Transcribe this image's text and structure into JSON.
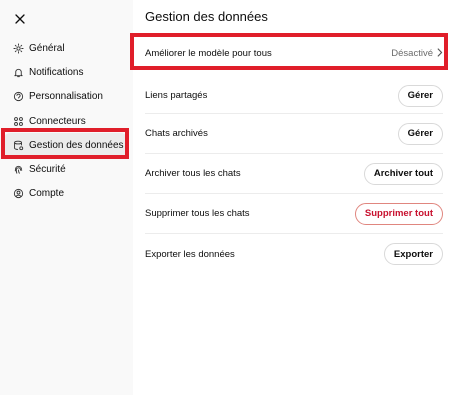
{
  "sidebar": {
    "close_icon": "close-icon",
    "items": [
      {
        "label": "Général",
        "icon": "gear-icon"
      },
      {
        "label": "Notifications",
        "icon": "bell-icon"
      },
      {
        "label": "Personnalisation",
        "icon": "personalization-icon"
      },
      {
        "label": "Connecteurs",
        "icon": "connectors-icon"
      },
      {
        "label": "Gestion des données",
        "icon": "database-icon",
        "active": true
      },
      {
        "label": "Sécurité",
        "icon": "fingerprint-icon"
      },
      {
        "label": "Compte",
        "icon": "account-icon"
      }
    ]
  },
  "main": {
    "title": "Gestion des données",
    "rows": [
      {
        "label": "Améliorer le modèle pour tous",
        "value": "Désactivé"
      },
      {
        "label": "Liens partagés",
        "button": "Gérer"
      },
      {
        "label": "Chats archivés",
        "button": "Gérer"
      },
      {
        "label": "Archiver tous les chats",
        "button": "Archiver tout"
      },
      {
        "label": "Supprimer tous les chats",
        "button": "Supprimer tout",
        "danger": true
      },
      {
        "label": "Exporter les données",
        "button": "Exporter"
      }
    ]
  },
  "colors": {
    "highlight": "#e01e2a",
    "danger": "#c8102e",
    "sidebar_bg": "#f9f9f9",
    "active_bg": "#ececec"
  }
}
